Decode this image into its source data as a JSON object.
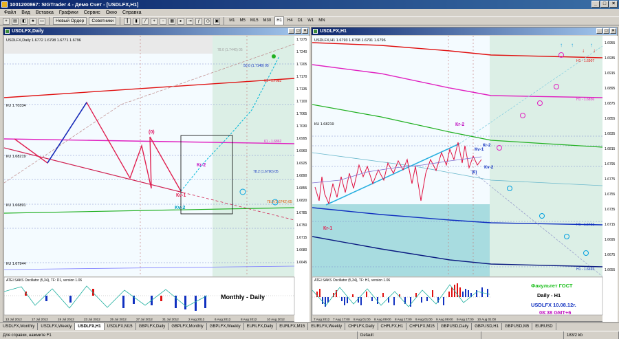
{
  "window": {
    "title": "10012008​67: SIGTrader 4 - Демо Счет - [USDLFX,H1]"
  },
  "menu": [
    "Файл",
    "Вид",
    "Вставка",
    "Графики",
    "Сервис",
    "Окно",
    "Справка"
  ],
  "toolbar": {
    "new_order": "Новый Ордер",
    "advisors": "Советники",
    "timeframes": [
      "M1",
      "M5",
      "M15",
      "M30",
      "H1",
      "H4",
      "D1",
      "W1",
      "MN"
    ],
    "active_tf": "H1"
  },
  "left_chart": {
    "window_title": "USDLFX,Daily",
    "header": "USDLFX,Daily  1.6772 1.6798 1.6771 1.6796",
    "price_labels": [
      "1.7275",
      "1.7240",
      "1.7205",
      "1.7170",
      "1.7135",
      "1.7100",
      "1.7065",
      "1.7030",
      "1.6995",
      "1.6960",
      "1.6925",
      "1.6890",
      "1.6855",
      "1.6820",
      "1.6785",
      "1.6750",
      "1.6715",
      "1.6680",
      "1.6645"
    ],
    "level_labels": [
      "КU 1.70334",
      "КU 1.68219",
      "КU 1.66891",
      "КU 1.67944"
    ],
    "fib_labels": [
      "78.0 (1.7446) 05",
      "61 - 1.7082",
      "50.0 (1.7148) 05",
      "61 - 1.6862",
      "78.2 (1.6790) 05",
      "78.0 (1.6742) 05"
    ],
    "wave_labels": {
      "zero": "(0)",
      "kv1": "Кv-1",
      "kv2": "Кv-2",
      "kr2": "Кr-2"
    },
    "indicator_header": "ATEI SAKS Oscillator (5,34), TF: D1, version 1.06",
    "indicator_text": "Monthly - Daily",
    "date_labels": [
      "13 Jul 2012",
      "17 Jul 2012",
      "19 Jul 2012",
      "23 Jul 2012",
      "25 Jul 2012",
      "27 Jul 2012",
      "31 Jul 2012",
      "2 Aug 2012",
      "6 Aug 2012",
      "8 Aug 2012",
      "10 Aug 2012"
    ]
  },
  "right_chart": {
    "window_title": "USDLFX,H1",
    "header": "USDLFX,H1  1.6793 1.6798 1.6791 1.6796",
    "price_labels": [
      "1.6955",
      "1.6935",
      "1.6915",
      "1.6895",
      "1.6875",
      "1.6855",
      "1.6835",
      "1.6815",
      "1.6795",
      "1.6775",
      "1.6755",
      "1.6735",
      "1.6715",
      "1.6695",
      "1.6675",
      "1.6655"
    ],
    "level_labels": [
      "КU 1.68219",
      "H1 - 1.6907",
      "H1 - 1.6856",
      "H1 - 1.6733",
      "H1 - 1.6693"
    ],
    "wave_labels": {
      "kr2": "Кr-2",
      "kv1": "Кv-1",
      "kv2": "Кv-2",
      "kr1": "Кr-1",
      "zero": "(0)"
    },
    "indicator_header": "ATEI SAKS Oscillator (5,34), TF: H1, version 1.06",
    "promo": {
      "line1": "Факультет ГОСТ",
      "line2": "Daily - H1",
      "line3": "USDLFX 10.08.12г.",
      "line4": "08:38  GMT+6"
    },
    "date_labels": [
      "7 Aug 2012",
      "7 Aug 17:00",
      "8 Aug 01:00",
      "8 Aug 09:00",
      "8 Aug 17:00",
      "9 Aug 01:00",
      "9 Aug 09:00",
      "9 Aug 17:00",
      "10 Aug 01:00"
    ]
  },
  "symbol_tabs": [
    "USDLFX,Monthly",
    "USDLFX,Weekly",
    "USDLFX,H1",
    "USDLFX,M15",
    "GBPLFX,Daily",
    "GBPLFX,Monthly",
    "GBPLFX,Weekly",
    "EURLFX,Daily",
    "EURLFX,M15",
    "EURLFX,Weekly",
    "CHFLFX,Daily",
    "CHFLFX,H1",
    "CHFLFX,M15",
    "GBPUSD,Daily",
    "GBPUSD,H1",
    "GBPUSD,M5",
    "EURUSD"
  ],
  "active_symbol_tab": "USDLFX,H1",
  "status": {
    "help": "Для справки, нажмите F1",
    "profile": "Default",
    "connection": "183/2 kb"
  },
  "colors": {
    "red": "#e01010",
    "magenta": "#e020c0",
    "green": "#20b020",
    "blue": "#1030c0",
    "cyan": "#00b8d8",
    "navy": "#0a246a"
  }
}
